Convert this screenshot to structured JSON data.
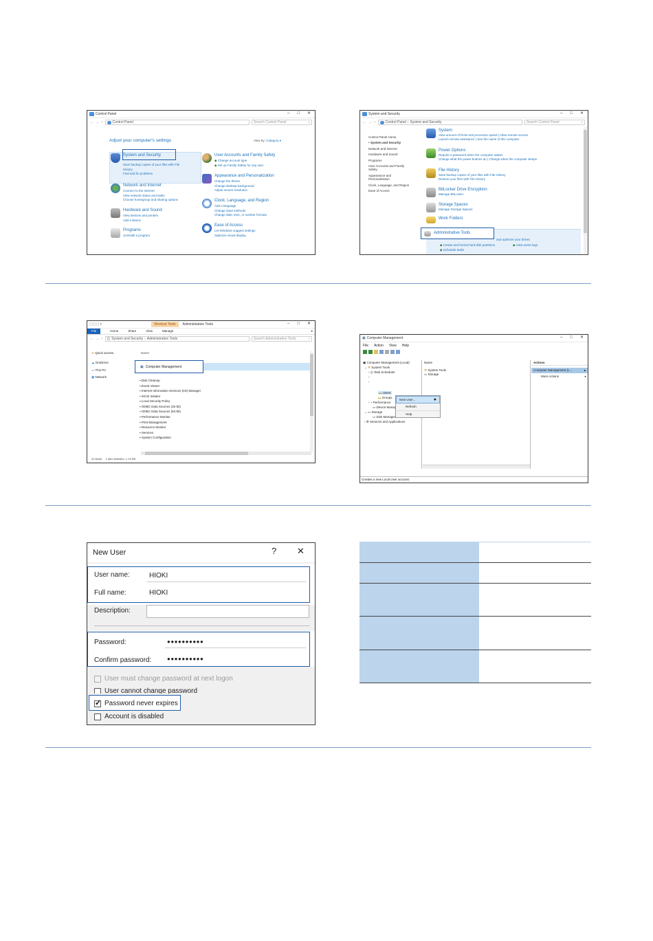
{
  "control_panel": {
    "title": "Control Panel",
    "path": "Control Panel",
    "search": "Search Control Panel",
    "heading": "Adjust your computer's settings",
    "view_by": "View by:",
    "category": "Category",
    "categories": [
      {
        "head": "System and Security",
        "subs": [
          "Save backup copies of your files with File",
          "History",
          "Find and fix problems"
        ]
      },
      {
        "head": "Network and Internet",
        "subs": [
          "Connect to the Internet",
          "View network status and tasks",
          "Choose homegroup and sharing options"
        ]
      },
      {
        "head": "Hardware and Sound",
        "subs": [
          "View devices and printers",
          "Add a device"
        ]
      },
      {
        "head": "Programs",
        "subs": [
          "Uninstall a program"
        ]
      },
      {
        "head": "User Accounts and Family Safety",
        "subs": [
          "Change account type",
          "Set up Family Safety for any user"
        ]
      },
      {
        "head": "Appearance and Personalization",
        "subs": [
          "Change the theme",
          "Change desktop background",
          "Adjust screen resolution"
        ]
      },
      {
        "head": "Clock, Language, and Region",
        "subs": [
          "Add a language",
          "Change input methods",
          "Change date, time, or number formats"
        ]
      },
      {
        "head": "Ease of Access",
        "subs": [
          "Let Windows suggest settings",
          "Optimize visual display"
        ]
      }
    ]
  },
  "sys_security": {
    "title": "System and Security",
    "path1": "Control Panel",
    "path2": "System and Security",
    "search": "Search Control Panel",
    "left": [
      "Control Panel Home",
      "System and Security",
      "Network and Internet",
      "Hardware and Sound",
      "Programs",
      "User Accounts and Family Safety",
      "Appearance and Personalization",
      "Clock, Language, and Region",
      "Ease of Access"
    ],
    "items": [
      {
        "head": "System",
        "sub": "View amount of RAM and processor speed  |  Allow remote access",
        "sub2": "Launch remote assistance  |  See the name of this computer"
      },
      {
        "head": "Power Options",
        "sub": "Require a password when the computer wakes",
        "sub2": "Change what the power buttons do  |  Change when the computer sleeps"
      },
      {
        "head": "File History",
        "sub": "Save backup copies of your files with File History",
        "sub2": "Restore your files with File History"
      },
      {
        "head": "BitLocker Drive Encryption",
        "sub": "Manage BitLocker",
        "sub2": ""
      },
      {
        "head": "Storage Spaces",
        "sub": "Manage Storage Spaces",
        "sub2": ""
      },
      {
        "head": "Work Folders",
        "sub": "",
        "sub2": ""
      }
    ],
    "admin_tools": "Administrative Tools",
    "admin_sub1": "and optimize your drives",
    "admin_sub2": "Create and format hard disk partitions",
    "admin_sub3": "View event logs",
    "admin_sub4": "Schedule tasks"
  },
  "explorer": {
    "tab_tools": "Shortcut Tools",
    "title": "Administrative Tools",
    "ribbon": [
      "File",
      "Home",
      "Share",
      "View",
      "Manage"
    ],
    "path1": "System and Security",
    "path2": "Administrative Tools",
    "search": "Search Administrative Tools",
    "col_name": "Name",
    "nav": [
      "Quick access",
      "OneDrive",
      "This PC",
      "Network"
    ],
    "selected": "Computer Management",
    "files": [
      "Disk Cleanup",
      "Event Viewer",
      "Internet Information Services (IIS) Manager",
      "iSCSI Initiator",
      "Local Security Policy",
      "ODBC Data Sources (32-bit)",
      "ODBC Data Sources (64-bit)",
      "Performance Monitor",
      "Print Management",
      "Resource Monitor",
      "Services",
      "System Configuration"
    ],
    "status": "22 items     1 item selected  1.13 KB"
  },
  "comp_mgmt": {
    "title": "Computer Management",
    "menu": [
      "File",
      "Action",
      "View",
      "Help"
    ],
    "tree": [
      "Computer Management (Local)",
      "System Tools",
      "Task Scheduler",
      "Users",
      "Groups",
      "Performance",
      "Device Manager",
      "Storage",
      "Disk Management",
      "Services and Applications"
    ],
    "col_name": "Name",
    "mid_items": [
      "System Tools",
      "Storage"
    ],
    "actions_head": "Actions",
    "actions_sel": "Computer Management (L...",
    "more_actions": "More Actions",
    "context": [
      "New User...",
      "Refresh",
      "Help"
    ],
    "status": "Creates a new Local User account."
  },
  "new_user": {
    "title": "New User",
    "help": "?",
    "close": "✕",
    "user_name_label": "User name:",
    "user_name": "HIOKI",
    "full_name_label": "Full name:",
    "full_name": "HIOKI",
    "description_label": "Description:",
    "password_label": "Password:",
    "password": "●●●●●●●●●●",
    "confirm_label": "Confirm password:",
    "confirm": "●●●●●●●●●●",
    "chk_must_change": "User must change password at next logon",
    "chk_cannot_change": "User cannot change password",
    "chk_never_expires": "Password never expires",
    "chk_disabled": "Account is disabled"
  }
}
